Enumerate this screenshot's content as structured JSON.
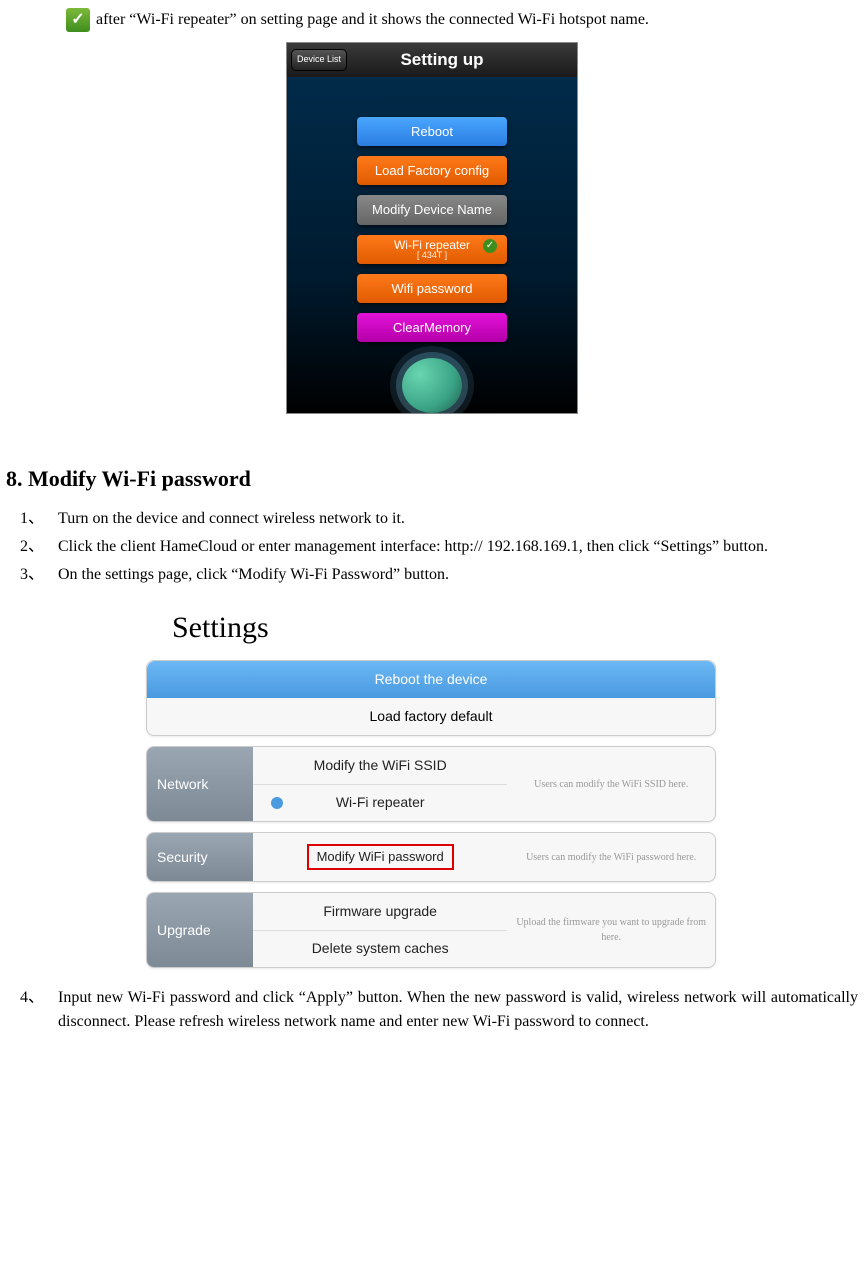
{
  "intro_text": "after “Wi-Fi repeater” on setting page and it shows the connected Wi-Fi hotspot name.",
  "phone": {
    "device_list": "Device List",
    "title": "Setting up",
    "btn_reboot": "Reboot",
    "btn_load": "Load Factory config",
    "btn_modify": "Modify Device Name",
    "btn_repeater": "Wi-Fi repeater",
    "btn_repeater_sub": "[ 434T ]",
    "btn_wifipw": "Wifi password",
    "btn_clear": "ClearMemory"
  },
  "section_title": "8. Modify Wi-Fi password",
  "steps": {
    "s1_num": "1、",
    "s1": "Turn on the device and connect wireless network to it.",
    "s2_num": "2、",
    "s2": "Click the client HameCloud or enter management interface: http:// 192.168.169.1, then click “Settings” button.",
    "s3_num": "3、",
    "s3": "On the settings page, click “Modify Wi-Fi Password” button.",
    "s4_num": "4、",
    "s4": "Input new Wi-Fi password and click “Apply” button. When the new password is valid, wireless network will automatically disconnect. Please refresh wireless network name and enter new Wi-Fi password to connect."
  },
  "settings": {
    "header": "Settings",
    "reboot": "Reboot the device",
    "load_default": "Load factory default",
    "network_label": "Network",
    "modify_ssid": "Modify the WiFi SSID",
    "wifi_repeater": "Wi-Fi repeater",
    "network_hint": "Users can modify the WiFi SSID here.",
    "security_label": "Security",
    "modify_pw": "Modify WiFi password",
    "security_hint": "Users can modify the WiFi password here.",
    "upgrade_label": "Upgrade",
    "firmware": "Firmware upgrade",
    "delete_caches": "Delete system caches",
    "upgrade_hint": "Upload the firmware you want to upgrade from here."
  }
}
